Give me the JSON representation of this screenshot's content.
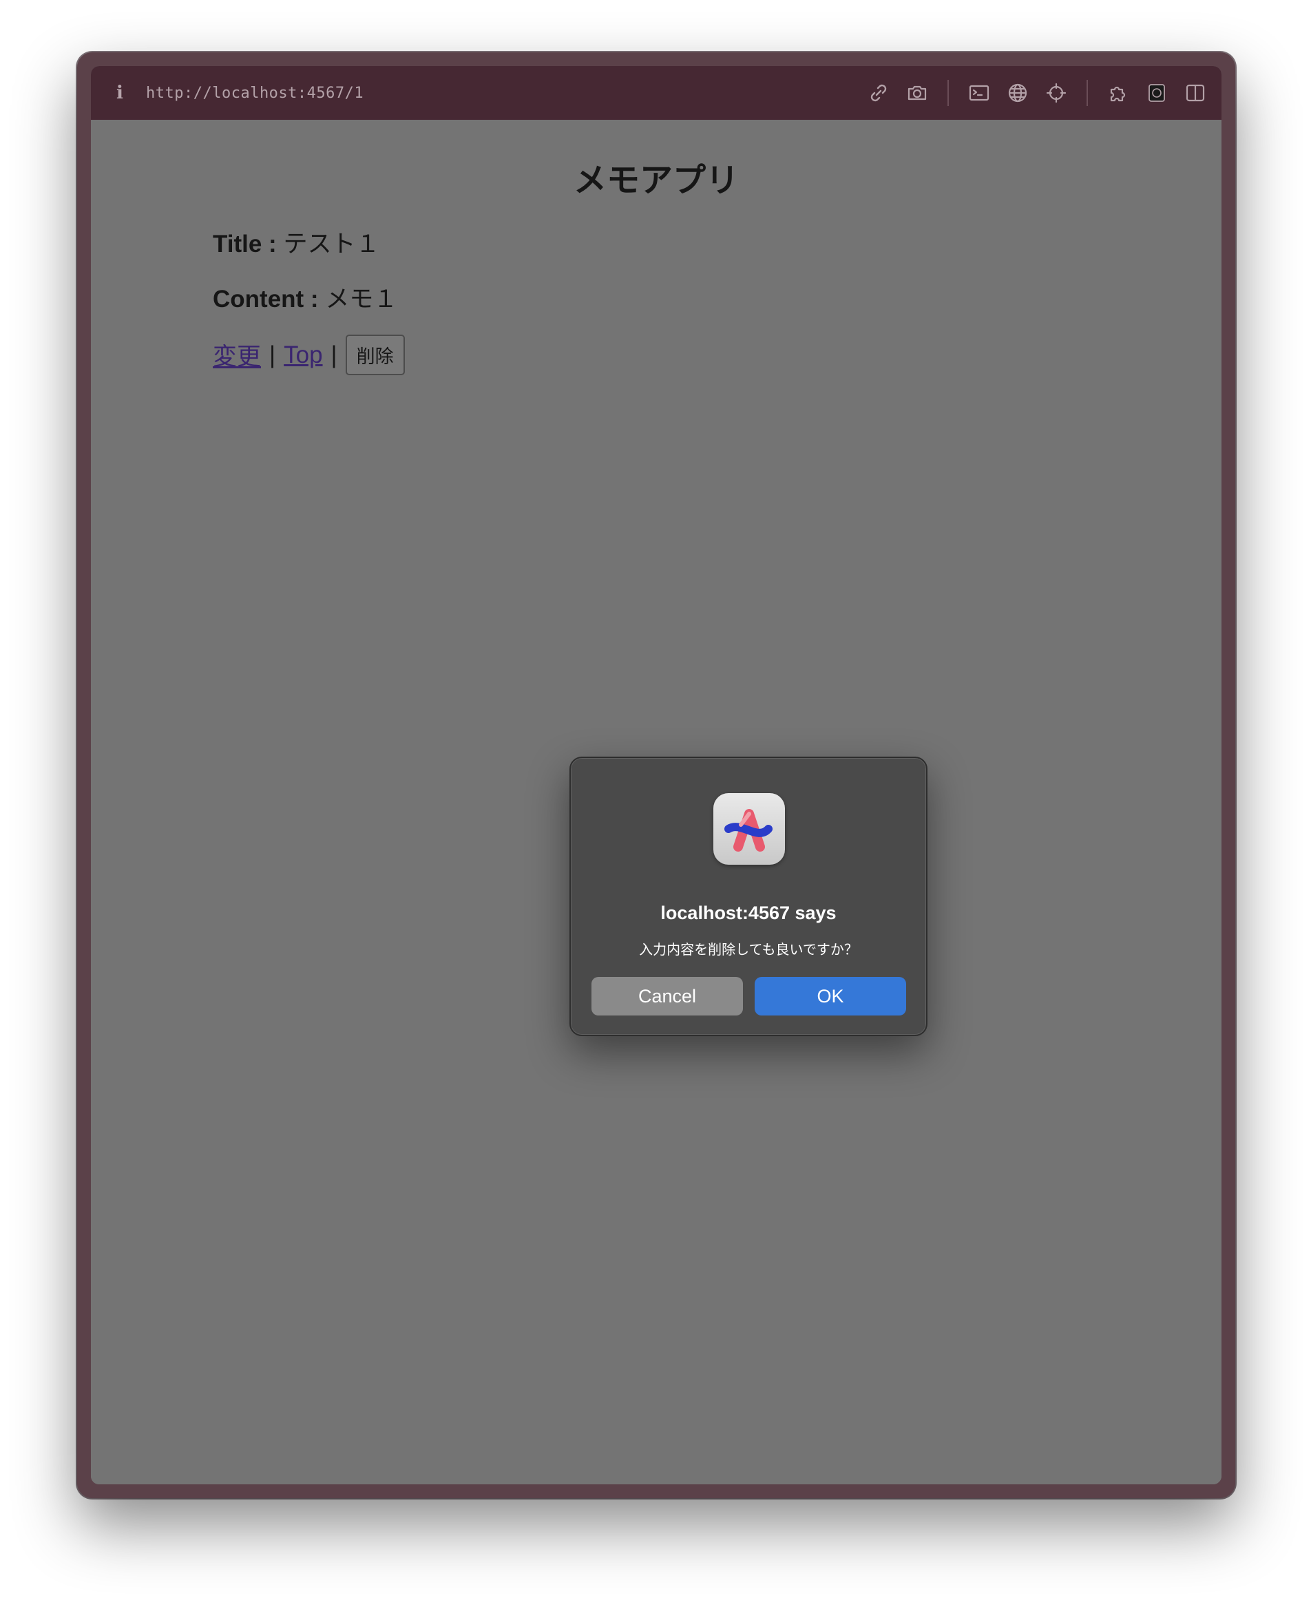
{
  "browser": {
    "info_icon": "i",
    "url": "http://localhost:4567/1",
    "toolbar_icons": [
      "link-icon",
      "camera-icon",
      "terminal-icon",
      "globe-icon",
      "crosshair-icon",
      "extension-icon",
      "capture-icon",
      "sidebar-icon"
    ]
  },
  "page": {
    "title": "メモアプリ",
    "title_field": {
      "label": "Title :",
      "value": "テスト１"
    },
    "content_field": {
      "label": "Content :",
      "value": "メモ１"
    },
    "actions": {
      "edit_link": "変更",
      "separator": "|",
      "top_link": "Top",
      "delete_button": "削除"
    }
  },
  "dialog": {
    "app_icon": "arc-browser-icon",
    "title": "localhost:4567 says",
    "message": "入力内容を削除しても良いですか？",
    "cancel_label": "Cancel",
    "ok_label": "OK"
  },
  "colors": {
    "topbar": "#462833",
    "frame": "#5b4149",
    "overlay_page": "#747474",
    "dialog_bg": "#4a4a4a",
    "ok_button": "#3578d8",
    "cancel_button": "#8a8a8a",
    "link": "#3a2570"
  }
}
